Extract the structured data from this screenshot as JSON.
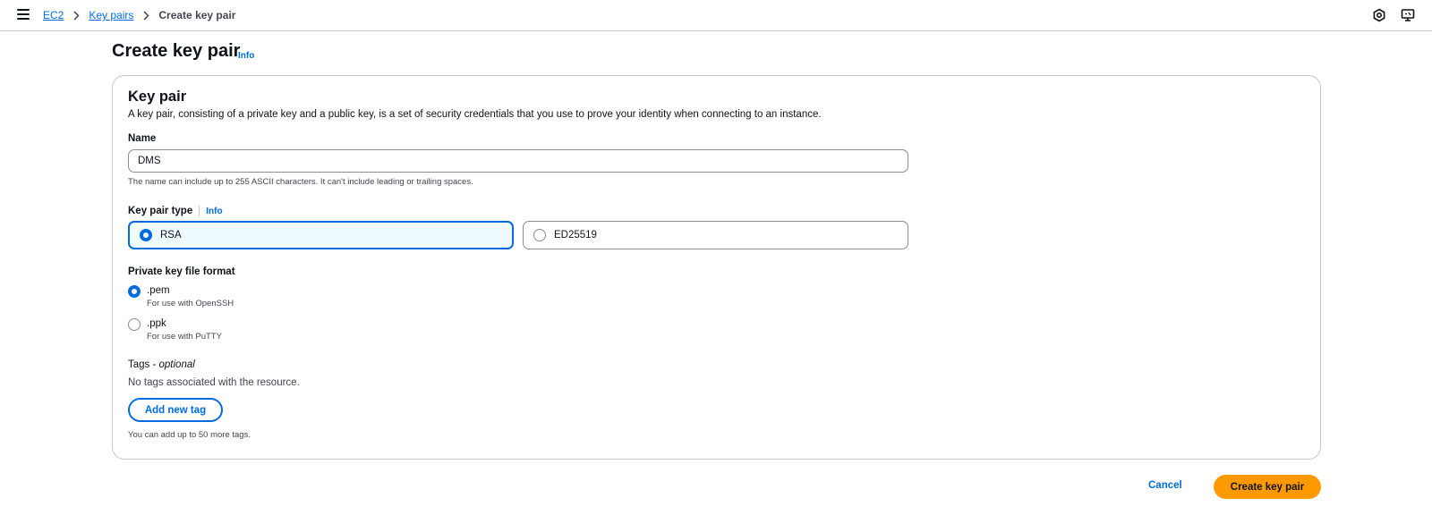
{
  "breadcrumb": {
    "items": [
      "EC2",
      "Key pairs"
    ],
    "current": "Create key pair"
  },
  "header_icons": [
    "settings-hex-icon",
    "screen-feedback-icon"
  ],
  "page": {
    "title": "Create key pair",
    "info": "Info"
  },
  "key_pair": {
    "heading": "Key pair",
    "description": "A key pair, consisting of a private key and a public key, is a set of security credentials that you use to prove your identity when connecting to an instance.",
    "name_label": "Name",
    "name_value": "DMS",
    "name_hint": "The name can include up to 255 ASCII characters. It can't include leading or trailing spaces.",
    "type_label": "Key pair type",
    "type_info": "Info",
    "type_options": [
      "RSA",
      "ED25519"
    ],
    "type_selected": "RSA",
    "format_label": "Private key file format",
    "format_options": [
      {
        "label": ".pem",
        "desc": "For use with OpenSSH"
      },
      {
        "label": ".ppk",
        "desc": "For use with PuTTY"
      }
    ],
    "format_selected": ".pem",
    "tags_label": "Tags - ",
    "tags_optional": "optional",
    "tags_empty": "No tags associated with the resource.",
    "add_tag_label": "Add new tag",
    "tags_hint": "You can add up to 50 more tags."
  },
  "actions": {
    "cancel": "Cancel",
    "create": "Create key pair"
  },
  "colors": {
    "link": "#006ce0",
    "primary_button": "#ff9900",
    "selected_tile_bg": "#f0fbff",
    "border": "#8c8c94"
  }
}
